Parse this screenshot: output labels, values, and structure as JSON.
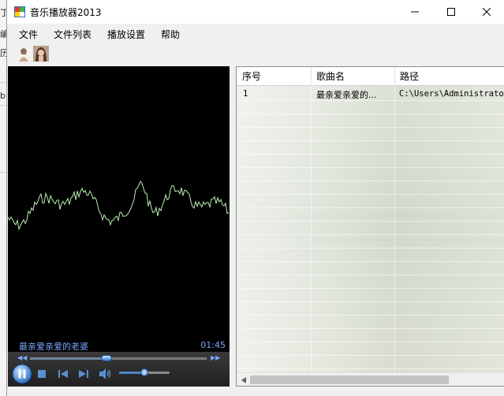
{
  "background_app": {
    "fragments": [
      "丁",
      "编",
      "历",
      "b"
    ]
  },
  "window": {
    "title": "音乐播放器2013",
    "icon": "app-music-icon",
    "controls": [
      "minimize-icon",
      "maximize-icon",
      "close-icon"
    ]
  },
  "menu": {
    "items": [
      "文件",
      "文件列表",
      "播放设置",
      "帮助"
    ]
  },
  "toolbar": {
    "buttons": [
      "skin-portrait-1-icon",
      "skin-portrait-2-icon"
    ]
  },
  "player": {
    "now_playing": "最亲爱亲爱的老婆",
    "time": "01:45",
    "seek_progress": 0.43,
    "volume_level": 0.5,
    "visualization": "waveform",
    "wave_color": "#b8f0b0",
    "accent": "#7da6ff",
    "controls": [
      "pause-icon",
      "stop-icon",
      "previous-icon",
      "next-icon",
      "speaker-icon"
    ]
  },
  "playlist": {
    "columns": [
      "序号",
      "歌曲名",
      "路径"
    ],
    "rows": [
      {
        "index": "1",
        "name": "最亲爱亲爱的...",
        "path": "C:\\Users\\Administrato"
      }
    ]
  }
}
